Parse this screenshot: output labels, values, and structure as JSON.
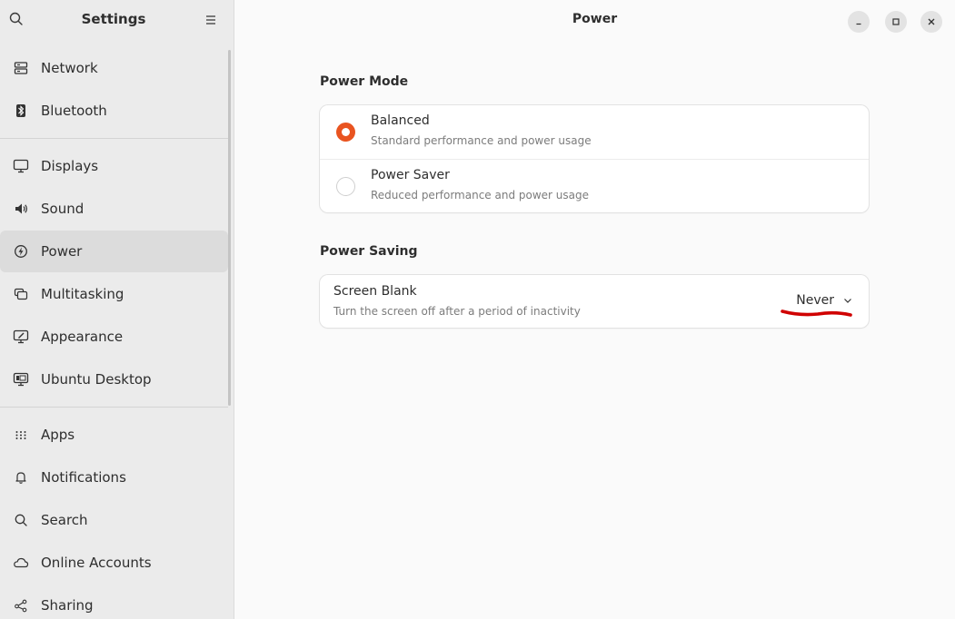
{
  "sidebar": {
    "title": "Settings",
    "items": [
      {
        "label": "Network",
        "icon": "network-icon"
      },
      {
        "label": "Bluetooth",
        "icon": "bluetooth-icon"
      },
      {
        "label": "Displays",
        "icon": "display-icon"
      },
      {
        "label": "Sound",
        "icon": "speaker-icon"
      },
      {
        "label": "Power",
        "icon": "power-icon",
        "active": true
      },
      {
        "label": "Multitasking",
        "icon": "multitasking-icon"
      },
      {
        "label": "Appearance",
        "icon": "appearance-icon"
      },
      {
        "label": "Ubuntu Desktop",
        "icon": "ubuntu-desktop-icon"
      },
      {
        "label": "Apps",
        "icon": "apps-grid-icon"
      },
      {
        "label": "Notifications",
        "icon": "bell-icon"
      },
      {
        "label": "Search",
        "icon": "search-icon"
      },
      {
        "label": "Online Accounts",
        "icon": "cloud-icon"
      },
      {
        "label": "Sharing",
        "icon": "share-icon"
      }
    ]
  },
  "main": {
    "title": "Power",
    "power_mode": {
      "heading": "Power Mode",
      "options": [
        {
          "label": "Balanced",
          "sub": "Standard performance and power usage",
          "selected": true
        },
        {
          "label": "Power Saver",
          "sub": "Reduced performance and power usage",
          "selected": false
        }
      ]
    },
    "power_saving": {
      "heading": "Power Saving",
      "screen_blank": {
        "label": "Screen Blank",
        "sub": "Turn the screen off after a period of inactivity",
        "value": "Never"
      }
    }
  },
  "colors": {
    "accent": "#e95420",
    "annotation": "#d00000"
  }
}
